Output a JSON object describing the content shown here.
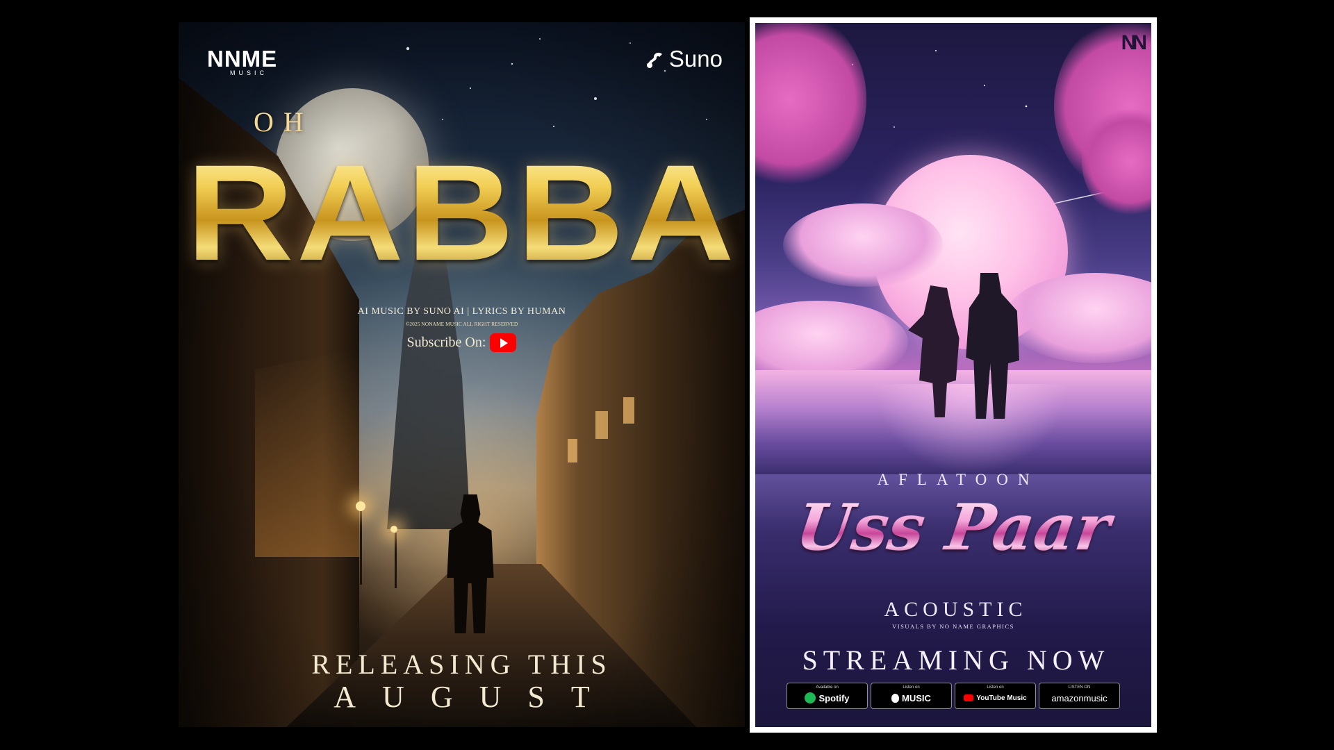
{
  "poster_left": {
    "brand_logo": "NNME",
    "brand_logo_sub": "MUSIC",
    "partner_logo": "Suno",
    "title_prefix": "OH",
    "title": "RABBA",
    "credits": "AI MUSIC BY SUNO AI | LYRICS BY HUMAN",
    "copyright": "©2025 NONAME MUSIC ALL RIGHT RESERVED",
    "subscribe_label": "Subscribe On:",
    "release_line1": "RELEASING THIS",
    "release_line2": "AUGUST",
    "icons": [
      "suno-icon",
      "youtube-icon"
    ]
  },
  "poster_right": {
    "logo": "NN",
    "artist": "AFLATOON",
    "title": "Uss Paar",
    "subtitle": "ACOUSTIC",
    "visuals_credit": "VISUALS BY NO NAME GRAPHICS",
    "streaming": "STREAMING NOW",
    "badges": [
      {
        "small": "Available on",
        "label": "Spotify"
      },
      {
        "small": "Listen on",
        "label": "MUSIC"
      },
      {
        "small": "Listen on",
        "label": "YouTube Music"
      },
      {
        "small": "LISTEN ON",
        "label": "amazonmusic"
      }
    ]
  },
  "colors": {
    "background": "#000000",
    "gold": "#e0b63a",
    "pink": "#f6b8e0",
    "youtube_red": "#ff0000",
    "spotify_green": "#1db954"
  }
}
